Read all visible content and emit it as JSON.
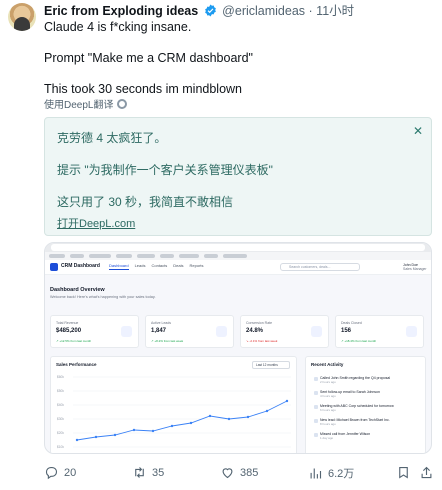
{
  "tweet": {
    "author": "Eric from Exploding ideas",
    "handle": "@ericlamideas",
    "separator": "·",
    "time": "11小时",
    "lines": [
      "Claude 4 is f*cking insane.",
      "Prompt \"Make me a CRM dashboard\"",
      "This took 30 seconds im mindblown"
    ],
    "translate_label": "使用DeepL翻译"
  },
  "deepl": {
    "lines": [
      "克劳德 4 太疯狂了。",
      "提示 \"为我制作一个客户关系管理仪表板\"",
      "这只用了 30 秒，我简直不敢相信"
    ],
    "close": "✕",
    "open_link": "打开DeepL.com"
  },
  "crm": {
    "app_title": "CRM Dashboard",
    "nav": [
      "Dashboard",
      "Leads",
      "Contacts",
      "Deals",
      "Reports"
    ],
    "search_placeholder": "Search customers, deals...",
    "user_name": "John Doe",
    "user_role": "Sales Manager",
    "overview_title": "Dashboard Overview",
    "overview_sub": "Welcome back! Here's what's happening with your sales today.",
    "cards": [
      {
        "label": "Total Revenue",
        "value": "$485,200",
        "change": "↗ +12.5% from last month",
        "color": "#16a34a"
      },
      {
        "label": "Active Leads",
        "value": "1,847",
        "change": "↗ +8.2% from last week",
        "color": "#16a34a"
      },
      {
        "label": "Conversion Rate",
        "value": "24.8%",
        "change": "↘ -2.1% from last week",
        "color": "#dc2626"
      },
      {
        "label": "Deals Closed",
        "value": "156",
        "change": "↗ +18.4% from last month",
        "color": "#16a34a"
      }
    ],
    "sales_title": "Sales Performance",
    "sales_range": "Last 12 months",
    "sales_y_ticks": [
      "$60k",
      "$50k",
      "$40k",
      "$30k",
      "$20k",
      "$10k"
    ],
    "activity_title": "Recent Activity",
    "activity": [
      {
        "text": "Called John Smith regarding the Q4 proposal",
        "ago": "2 hours ago"
      },
      {
        "text": "Sent follow-up email to Sarah Johnson",
        "ago": "4 hours ago"
      },
      {
        "text": "Meeting with ABC Corp scheduled for tomorrow",
        "ago": "6 hours ago"
      },
      {
        "text": "New lead: Michael Brown from TechStart Inc.",
        "ago": "8 hours ago"
      },
      {
        "text": "Missed call from Jennifer Wilson",
        "ago": "1 day ago"
      }
    ]
  },
  "actions": {
    "reply": "20",
    "retweet": "35",
    "like": "385",
    "views": "6.2万"
  },
  "colors": {
    "verified": "#1d9bf0",
    "deepl_text": "#2d6a62",
    "chart_line": "#3b82f6"
  }
}
